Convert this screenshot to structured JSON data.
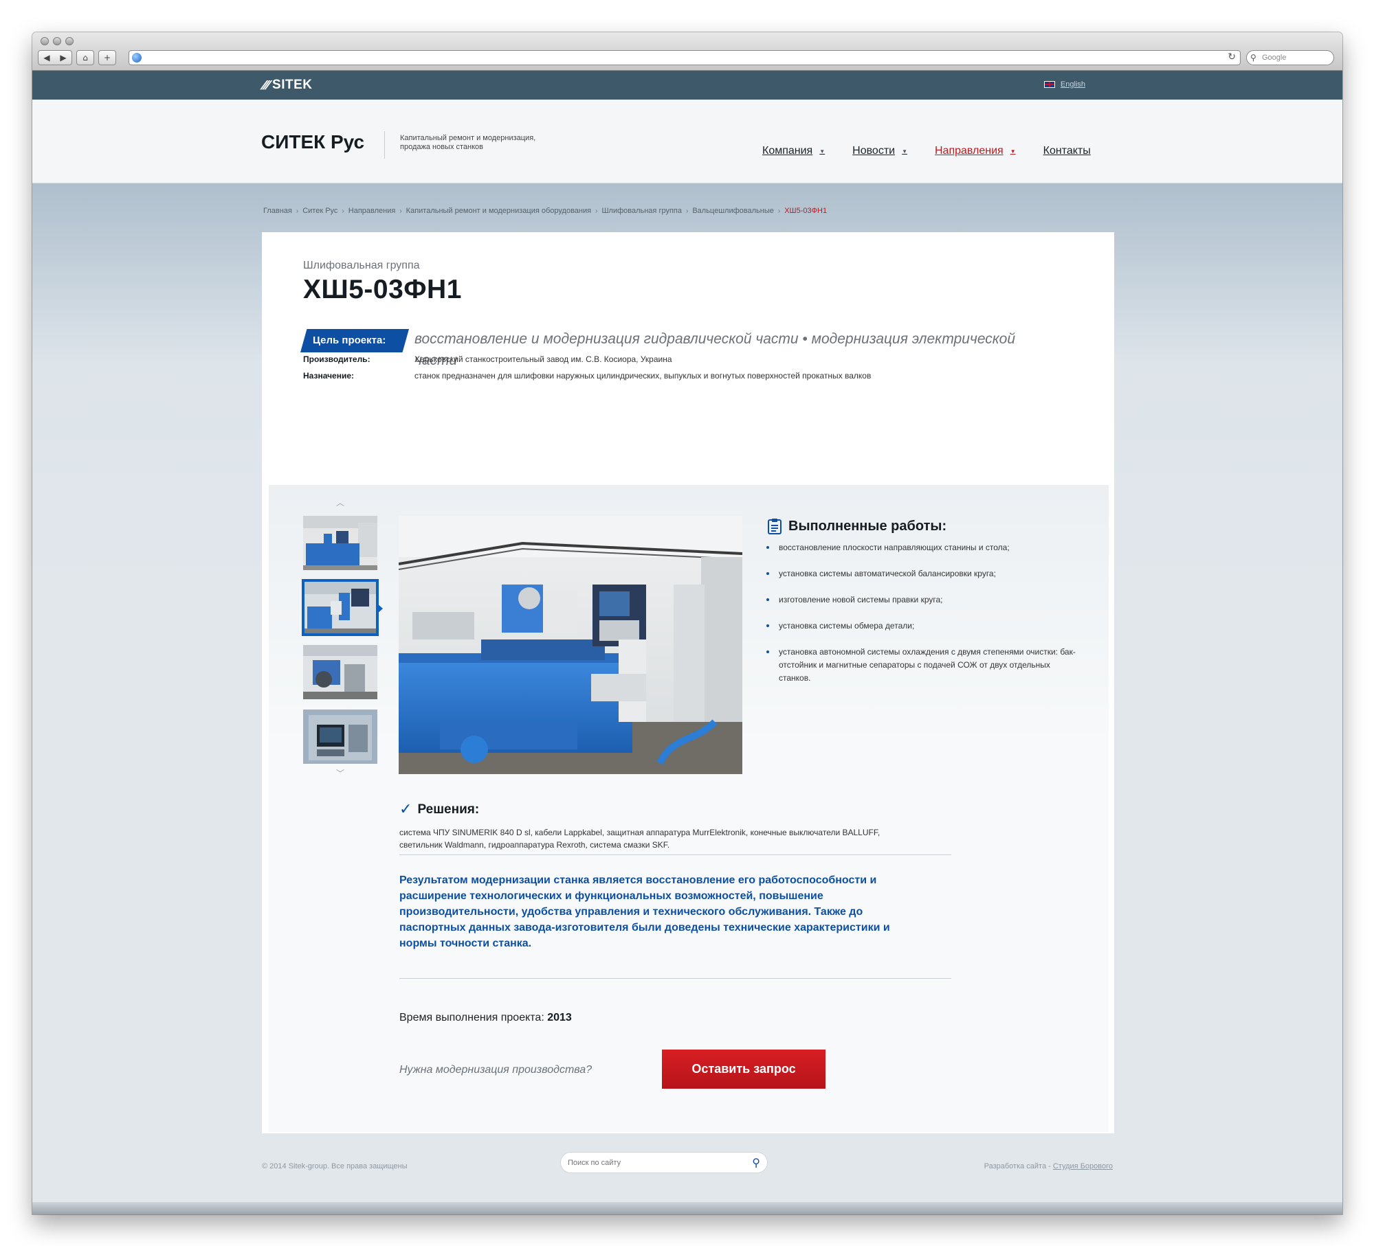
{
  "browser": {
    "search_placeholder": "Google",
    "icons": {
      "back": "back-arrow-icon",
      "forward": "forward-arrow-icon",
      "home": "home-icon",
      "add": "plus-icon",
      "reload": "reload-icon",
      "search": "search-icon"
    }
  },
  "topbar": {
    "brand": "SITEK",
    "lang_label": "English"
  },
  "header": {
    "logo": "СИТЕК Рус",
    "tagline": "Капитальный ремонт и модернизация, продажа новых станков",
    "nav": [
      {
        "label": "Компания",
        "active": false
      },
      {
        "label": "Новости",
        "active": false
      },
      {
        "label": "Направления",
        "active": true
      },
      {
        "label": "Контакты",
        "active": false
      }
    ]
  },
  "breadcrumb": [
    "Главная",
    "Ситек Рус",
    "Направления",
    "Капитальный ремонт и модернизация оборудования",
    "Шлифовальная группа",
    "Вальцешлифовальные",
    "ХШ5-03ФН1"
  ],
  "project": {
    "category": "Шлифовальная группа",
    "title": "ХШ5-03ФН1",
    "goal_label": "Цель проекта:",
    "goal_text": "восстановление и модернизация гидравлической части • модернизация электрической части",
    "manufacturer_label": "Производитель:",
    "manufacturer": "Харьковский станкостроительный завод им. С.В. Косиора, Украина",
    "purpose_label": "Назначение:",
    "purpose": "станок предназначен для шлифовки наружных цилиндрических, выпуклых и вогнутых поверхностей прокатных валков"
  },
  "works": {
    "heading": "Выполненные работы:",
    "items": [
      "восстановление плоскости направляющих станины и стола;",
      "установка системы автоматической балансировки круга;",
      "изготовление новой системы правки круга;",
      "установка системы обмера детали;",
      "установка автономной системы охлаждения с двумя степенями очистки: бак-отстойник и магнитные сепараторы с подачей СОЖ от двух отдельных станков."
    ]
  },
  "solutions": {
    "heading": "Решения:",
    "text": "система ЧПУ SINUMERIK 840 D sl, кабели Lappkabel, защитная аппаратура MurrElektronik, конечные выключатели BALLUFF, светильник Waldmann, гидроаппаратура Rexroth, система смазки SKF."
  },
  "result": "Результатом модернизации станка является восстановление его работоспособности и расширение технологических и функциональных возможностей, повышение производительности, удобства управления и технического обслуживания. Также до паспортных данных завода-изготовителя были доведены технические характеристики и нормы точности станка.",
  "time": {
    "label": "Время выполнения проекта:",
    "value": "2013"
  },
  "cta": {
    "question": "Нужна модернизация производства?",
    "button": "Оставить запрос"
  },
  "footer": {
    "copyright": "© 2014 Sitek-group. Все права защищены",
    "search_placeholder": "Поиск по сайту",
    "dev_label": "Разработка сайта - ",
    "dev_link": "Студия Борового"
  },
  "colors": {
    "accent_blue": "#0d4fa2",
    "accent_red": "#c4171c",
    "topbar": "#3e5a6a"
  }
}
